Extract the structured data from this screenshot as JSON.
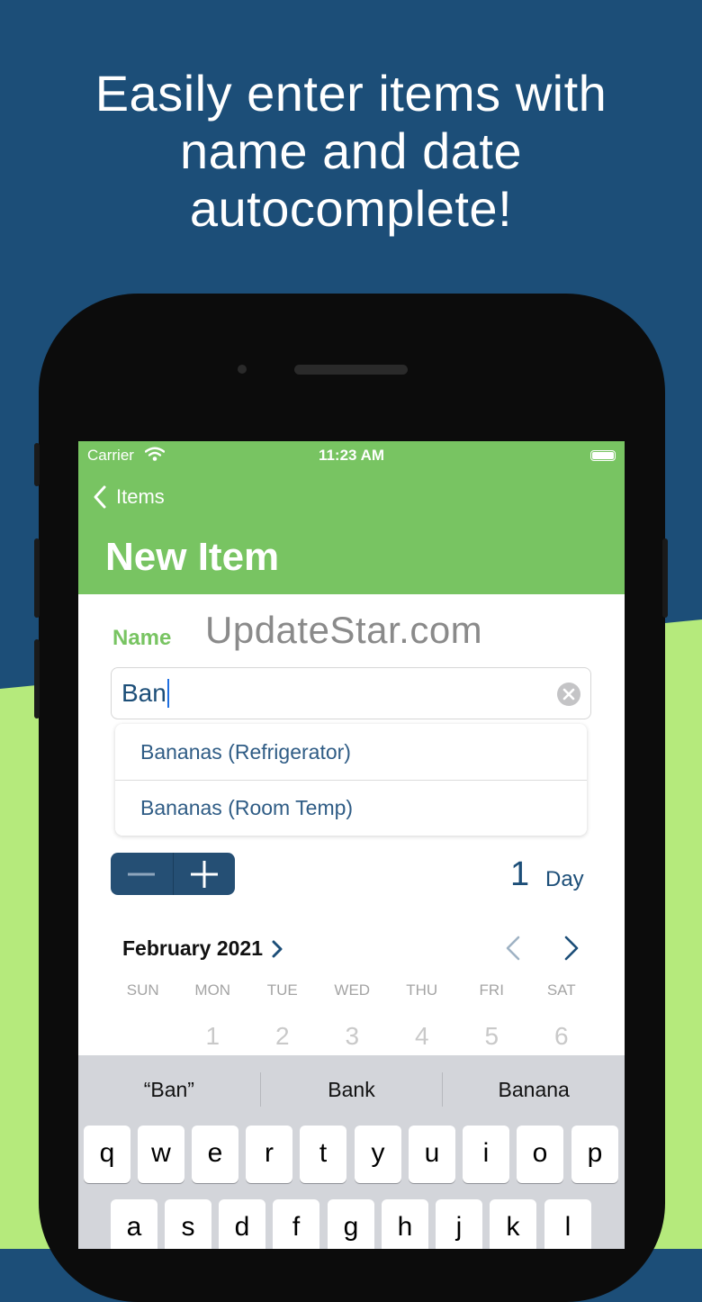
{
  "headline": [
    "Easily enter items with",
    "name and date",
    "autocomplete!"
  ],
  "status_bar": {
    "carrier": "Carrier",
    "time": "11:23 AM"
  },
  "nav": {
    "back_label": "Items",
    "title": "New Item"
  },
  "form": {
    "name_label": "Name",
    "watermark": "UpdateStar.com",
    "name_value": "Ban",
    "suggestions": [
      "Bananas (Refrigerator)",
      "Bananas (Room Temp)"
    ],
    "duration_value": "1",
    "duration_unit": "Day"
  },
  "calendar": {
    "month": "February 2021",
    "weekdays": [
      "SUN",
      "MON",
      "TUE",
      "WED",
      "THU",
      "FRI",
      "SAT"
    ],
    "days": [
      "",
      "1",
      "2",
      "3",
      "4",
      "5",
      "6"
    ]
  },
  "keyboard": {
    "predictions": [
      "“Ban”",
      "Bank",
      "Banana"
    ],
    "row1": [
      "q",
      "w",
      "e",
      "r",
      "t",
      "y",
      "u",
      "i",
      "o",
      "p"
    ],
    "row2": [
      "a",
      "s",
      "d",
      "f",
      "g",
      "h",
      "j",
      "k",
      "l"
    ]
  },
  "colors": {
    "navy": "#1c4e78",
    "green_nav": "#78c462",
    "light_green": "#b5ea7c",
    "stepper": "#254f74"
  },
  "icons": {
    "back": "chevron-left-icon",
    "clear": "clear-circle-icon",
    "wifi": "wifi-icon",
    "battery": "battery-icon",
    "minus": "minus-icon",
    "plus": "plus-icon",
    "month_disclosure": "chevron-right-icon",
    "prev_month": "chevron-left-icon",
    "next_month": "chevron-right-icon"
  }
}
